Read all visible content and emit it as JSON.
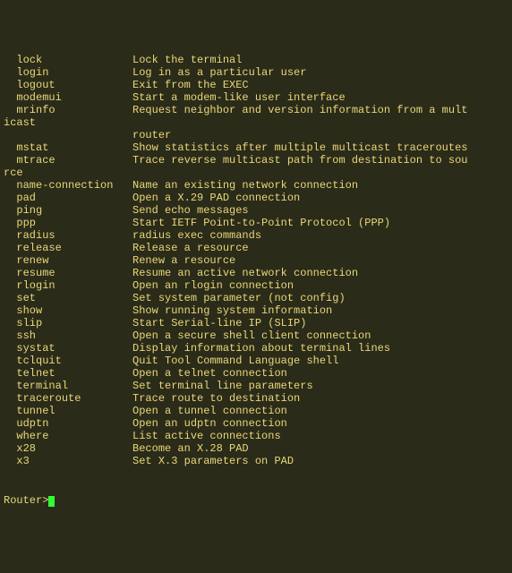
{
  "rows": [
    {
      "indent": 2,
      "cmd": "lock",
      "desc": "Lock the terminal"
    },
    {
      "indent": 2,
      "cmd": "login",
      "desc": "Log in as a particular user"
    },
    {
      "indent": 2,
      "cmd": "logout",
      "desc": "Exit from the EXEC"
    },
    {
      "indent": 2,
      "cmd": "modemui",
      "desc": "Start a modem-like user interface"
    },
    {
      "indent": 2,
      "cmd": "mrinfo",
      "desc": "Request neighbor and version information from a mult"
    },
    {
      "indent": 0,
      "cmd": "",
      "pad": 0,
      "fullline": "icast"
    },
    {
      "indent": 0,
      "cmd": "",
      "pad": 20,
      "fullline": "router"
    },
    {
      "indent": 2,
      "cmd": "mstat",
      "desc": "Show statistics after multiple multicast traceroutes"
    },
    {
      "indent": 2,
      "cmd": "mtrace",
      "desc": "Trace reverse multicast path from destination to sou"
    },
    {
      "indent": 0,
      "cmd": "",
      "pad": 0,
      "fullline": "rce"
    },
    {
      "indent": 2,
      "cmd": "name-connection",
      "desc": "Name an existing network connection"
    },
    {
      "indent": 2,
      "cmd": "pad",
      "desc": "Open a X.29 PAD connection"
    },
    {
      "indent": 2,
      "cmd": "ping",
      "desc": "Send echo messages"
    },
    {
      "indent": 2,
      "cmd": "ppp",
      "desc": "Start IETF Point-to-Point Protocol (PPP)"
    },
    {
      "indent": 2,
      "cmd": "radius",
      "desc": "radius exec commands"
    },
    {
      "indent": 2,
      "cmd": "release",
      "desc": "Release a resource"
    },
    {
      "indent": 2,
      "cmd": "renew",
      "desc": "Renew a resource"
    },
    {
      "indent": 2,
      "cmd": "resume",
      "desc": "Resume an active network connection"
    },
    {
      "indent": 2,
      "cmd": "rlogin",
      "desc": "Open an rlogin connection"
    },
    {
      "indent": 2,
      "cmd": "set",
      "desc": "Set system parameter (not config)"
    },
    {
      "indent": 2,
      "cmd": "show",
      "desc": "Show running system information"
    },
    {
      "indent": 2,
      "cmd": "slip",
      "desc": "Start Serial-line IP (SLIP)"
    },
    {
      "indent": 2,
      "cmd": "ssh",
      "desc": "Open a secure shell client connection"
    },
    {
      "indent": 2,
      "cmd": "systat",
      "desc": "Display information about terminal lines"
    },
    {
      "indent": 2,
      "cmd": "tclquit",
      "desc": "Quit Tool Command Language shell"
    },
    {
      "indent": 2,
      "cmd": "telnet",
      "desc": "Open a telnet connection"
    },
    {
      "indent": 2,
      "cmd": "terminal",
      "desc": "Set terminal line parameters"
    },
    {
      "indent": 2,
      "cmd": "traceroute",
      "desc": "Trace route to destination"
    },
    {
      "indent": 2,
      "cmd": "tunnel",
      "desc": "Open a tunnel connection"
    },
    {
      "indent": 2,
      "cmd": "udptn",
      "desc": "Open an udptn connection"
    },
    {
      "indent": 2,
      "cmd": "where",
      "desc": "List active connections"
    },
    {
      "indent": 2,
      "cmd": "x28",
      "desc": "Become an X.28 PAD"
    },
    {
      "indent": 2,
      "cmd": "x3",
      "desc": "Set X.3 parameters on PAD"
    }
  ],
  "prompt": "Router>"
}
